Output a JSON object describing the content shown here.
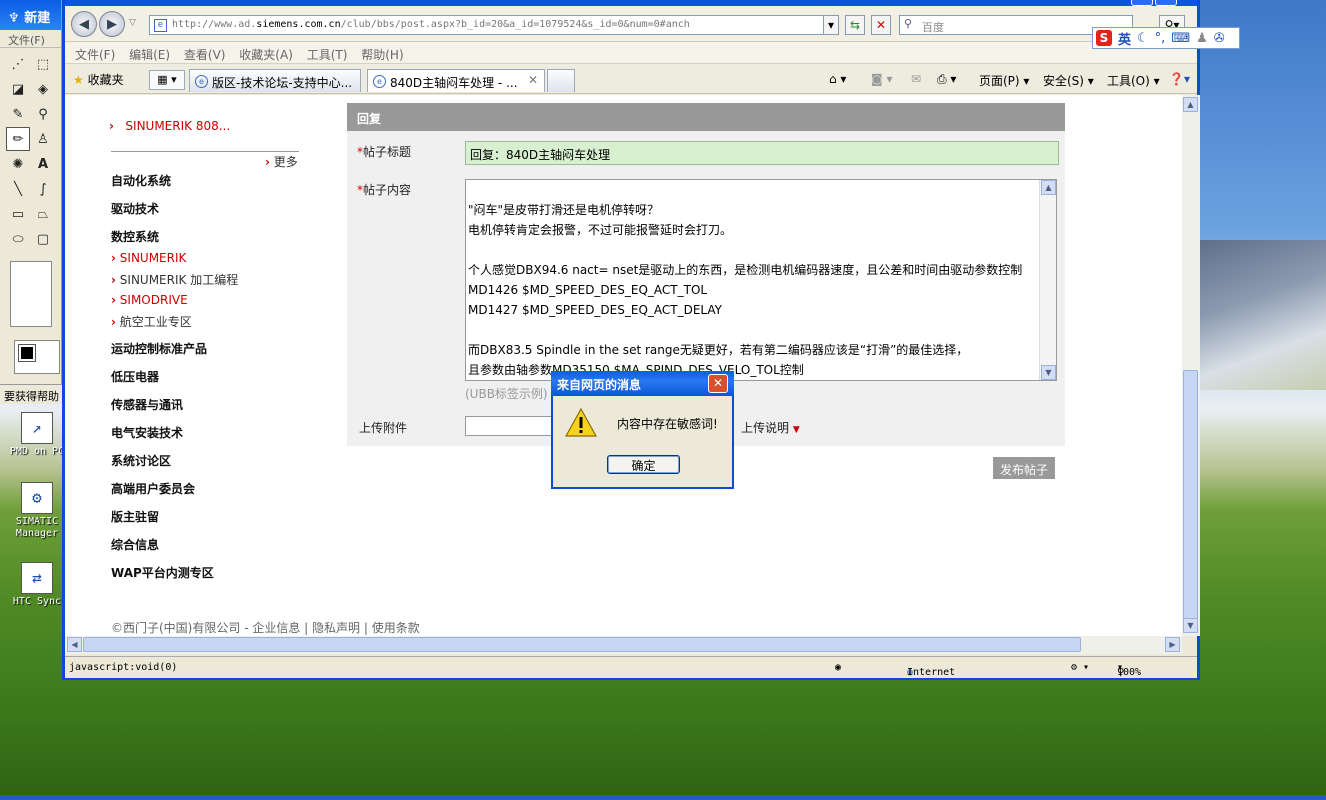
{
  "paint": {
    "title": "新建",
    "menu": "文件(F)",
    "help_text": "要获得帮助"
  },
  "desktop": {
    "icons": [
      {
        "label": "PMD on PC",
        "icon": "pmd-shortcut-icon"
      },
      {
        "label": "SIMATIC Manager",
        "icon": "simatic-manager-icon"
      },
      {
        "label": "HTC Sync",
        "icon": "htc-sync-icon"
      }
    ]
  },
  "browser": {
    "address": {
      "prefix": "http://www.ad.",
      "domain": "siemens.com.cn",
      "path": "/club/bbs/post.aspx?b_id=20&a_id=1079524&s_id=0&num=0#anch"
    },
    "search_placeholder": "百度",
    "menu": [
      "文件(F)",
      "编辑(E)",
      "查看(V)",
      "收藏夹(A)",
      "工具(T)",
      "帮助(H)"
    ],
    "favorites_label": "收藏夹",
    "tabs": [
      {
        "label": "版区-技术论坛-支持中心..."
      },
      {
        "label": "840D主轴闷车处理 - ..."
      }
    ],
    "command_bar": {
      "page": "页面(P)",
      "safety": "安全(S)",
      "tools": "工具(O)"
    },
    "status": {
      "text": "javascript:void(0)",
      "zone": "Internet",
      "zoom": "100%"
    }
  },
  "ime": {
    "logo": "S",
    "mode": "英"
  },
  "sidebar": {
    "top_item": "SINUMERIK 808...",
    "more": "更多",
    "categories": [
      "自动化系统",
      "驱动技术",
      "数控系统",
      "运动控制标准产品",
      "低压电器",
      "传感器与通讯",
      "电气安装技术",
      "系统讨论区",
      "高端用户委员会",
      "版主驻留",
      "综合信息",
      "WAP平台内测专区"
    ],
    "cnc_items": [
      "SINUMERIK",
      "SINUMERIK 加工编程",
      "SIMODRIVE",
      "航空工业专区"
    ]
  },
  "form": {
    "header": "回复",
    "title_label": "帖子标题",
    "title_value": "回复：840D主轴闷车处理",
    "content_label": "帖子内容",
    "content_lines": [
      "\"闷车\"是皮带打滑还是电机停转呀？",
      "电机停转肯定会报警，不过可能报警延时会打刀。",
      "",
      "个人感觉DBX94.6 nact= nset是驱动上的东西，是检测电机编码器速度，且公差和时间由驱动参数控制",
      "MD1426 $MD_SPEED_DES_EQ_ACT_TOL",
      "MD1427 $MD_SPEED_DES_EQ_ACT_DELAY",
      "",
      "而DBX83.5 Spindle in the set range无疑更好，若有第二编码器应该是“打滑”的最佳选择，",
      "且参数由轴参数MD35150 $MA_SPIND_DES_VELO_TOL控制"
    ],
    "ubb_hint": "(UBB标签示例)",
    "upload_label": "上传附件",
    "upload_note": "上传说明",
    "publish": "发布帖子",
    "required_mark": "*"
  },
  "footer": {
    "copyright": "©西门子(中国)有限公司",
    "links": [
      "企业信息",
      "隐私声明",
      "使用条款"
    ]
  },
  "dialog": {
    "title": "来自网页的消息",
    "message": "内容中存在敏感词!",
    "ok": "确定"
  }
}
